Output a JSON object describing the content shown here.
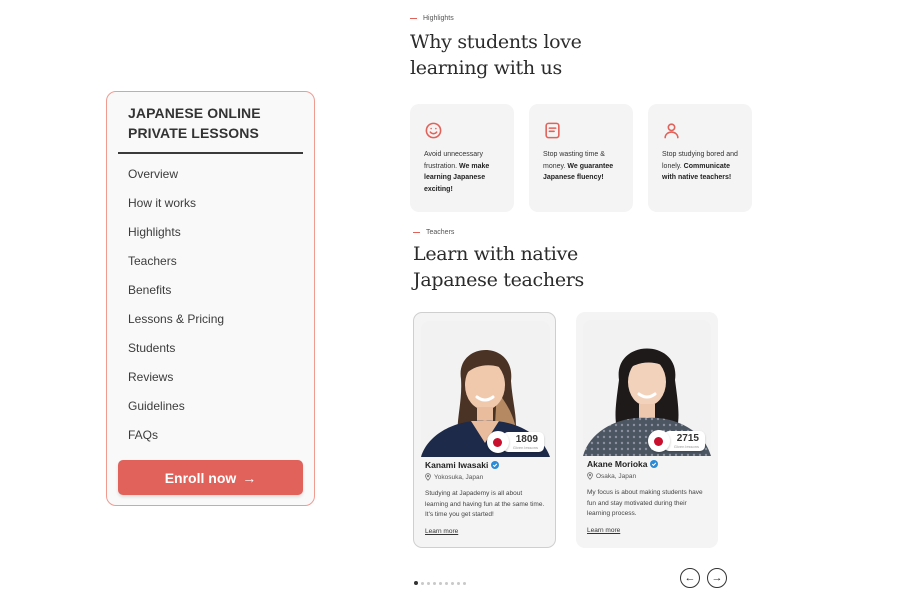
{
  "sidebar": {
    "title_line1": "JAPANESE ONLINE",
    "title_line2": "PRIVATE LESSONS",
    "items": [
      {
        "label": "Overview"
      },
      {
        "label": "How it works"
      },
      {
        "label": "Highlights"
      },
      {
        "label": "Teachers"
      },
      {
        "label": "Benefits"
      },
      {
        "label": "Lessons & Pricing"
      },
      {
        "label": "Students"
      },
      {
        "label": "Reviews"
      },
      {
        "label": "Guidelines"
      },
      {
        "label": "FAQs"
      }
    ],
    "enroll_label": "Enroll now",
    "enroll_arrow": "→"
  },
  "highlights": {
    "eyebrow": "Highlights",
    "heading_line1": "Why students love",
    "heading_line2": "learning with us",
    "cards": [
      {
        "icon": "smile-icon",
        "text": "Avoid unnecessary frustration.",
        "bold": "We make learning Japanese exciting!"
      },
      {
        "icon": "message-square-icon",
        "text": "Stop wasting time & money.",
        "bold": "We guarantee Japanese fluency!"
      },
      {
        "icon": "user-icon",
        "text": "Stop studying bored and lonely.",
        "bold": "Communicate with native teachers!"
      }
    ]
  },
  "teachers": {
    "eyebrow": "Teachers",
    "heading_line1": "Learn with native",
    "heading_line2": "Japanese teachers",
    "cards": [
      {
        "name": "Kanami Iwasaki",
        "location": "Yokosuka, Japan",
        "lessons": "1809",
        "lessons_label": "Given lessons",
        "bio": "Studying at Japademy is all about learning and having fun at the same time. It's time you get started!",
        "learn_more": "Learn more"
      },
      {
        "name": "Akane Morioka",
        "location": "Osaka, Japan",
        "lessons": "2715",
        "lessons_label": "Given lessons",
        "bio": "My focus is about making students have fun and stay motivated during their learning process.",
        "learn_more": "Learn more"
      }
    ],
    "pager": {
      "total": 9,
      "current": 1
    },
    "prev_arrow": "←",
    "next_arrow": "→"
  },
  "colors": {
    "accent": "#e0625a",
    "sidebar_border": "#f19a90",
    "card_bg": "#f4f4f4",
    "verified": "#2a8bd8",
    "flag_red": "#c8102e"
  }
}
